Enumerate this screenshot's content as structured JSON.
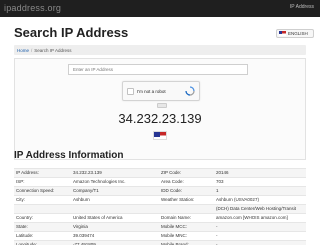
{
  "header": {
    "logo": "ipaddress.org",
    "nav_link": "IP Address"
  },
  "page_title": "Search IP Address",
  "language": {
    "label": "ENGLISH",
    "flag": "us-flag-icon"
  },
  "breadcrumb": {
    "home": "Home",
    "separator": "/",
    "current": "Search IP Address"
  },
  "search": {
    "placeholder": "Enter an IP Address",
    "value": ""
  },
  "captcha": {
    "label": "I'm not a robot",
    "checked": false
  },
  "result": {
    "ip": "34.232.23.139"
  },
  "section_title": "IP Address Information",
  "info_rows": [
    {
      "l1": "IP Address:",
      "v1": "34.232.23.139",
      "v1_link": true,
      "l2": "ZIP Code:",
      "v2": "20146",
      "v2_link": false
    },
    {
      "l1": "ISP:",
      "v1": "Amazon Technologies Inc.",
      "v1_link": true,
      "l2": "Area Code:",
      "v2": "703",
      "v2_link": false
    },
    {
      "l1": "Connection Speed:",
      "v1": "Company/T1",
      "v1_link": false,
      "l2": "IDD Code:",
      "v2": "1",
      "v2_link": false
    },
    {
      "l1": "City:",
      "v1": "Ashburn",
      "v1_link": false,
      "l2": "Weather Station:",
      "v2": "Ashburn (USVA0027)",
      "v2_link": false
    },
    {
      "l1": "",
      "v1": "",
      "v1_link": false,
      "l2": "",
      "v2": "(DCH) Data Center/Web Hosting/Transit",
      "v2_link": false
    },
    {
      "l1": "Country:",
      "v1": "United States of America",
      "v1_link": false,
      "l2": "Domain Name:",
      "v2": "amazon.com [WHOIS amazon.com]",
      "v2_link": false
    },
    {
      "l1": "State:",
      "v1": "Virginia",
      "v1_link": false,
      "l2": "Mobile MCC:",
      "v2": "-",
      "v2_link": false
    },
    {
      "l1": "Latitude:",
      "v1": "39.039474",
      "v1_link": false,
      "l2": "Mobile MNC:",
      "v2": "-",
      "v2_link": false
    },
    {
      "l1": "Longitude:",
      "v1": "-77.491809",
      "v1_link": false,
      "l2": "Mobile Brand:",
      "v2": "-",
      "v2_link": false
    }
  ]
}
